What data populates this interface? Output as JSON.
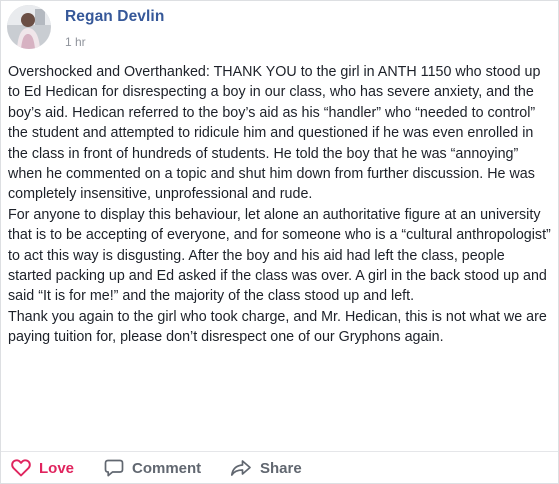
{
  "post": {
    "author": "Regan Devlin",
    "timestamp": "1 hr",
    "paragraphs": [
      "Overshocked and Overthanked: THANK YOU to the girl in ANTH 1150 who stood up to Ed Hedican for disrespecting a boy in our class, who has severe anxiety, and the boy’s aid. Hedican referred to the boy’s aid as his “handler” who “needed to control” the student and attempted to ridicule him and questioned if he was even enrolled in the class in front of hundreds of students. He told the boy that he was “annoying” when he commented on a topic and shut him down from further discussion. He was completely insensitive, unprofessional and rude.",
      "For anyone to display this behaviour, let alone an authoritative figure at an university that is to be accepting of everyone, and for someone who is a “cultural anthropologist” to act this way is disgusting. After the boy and his aid had left the class, people started packing up and Ed asked if the class was over. A girl in the back stood up and said “It is for me!” and the majority of the class stood up and left.",
      "Thank you again to the girl who took charge, and Mr. Hedican, this is not what we are paying tuition for, please don’t disrespect one of our Gryphons again."
    ]
  },
  "actions": {
    "love_label": "Love",
    "comment_label": "Comment",
    "share_label": "Share"
  },
  "icons": {
    "love": "heart-icon",
    "comment": "speech-bubble-icon",
    "share": "share-arrow-icon"
  },
  "colors": {
    "author_link": "#365899",
    "love_active": "#e0245e",
    "action_gray": "#616770",
    "timestamp_gray": "#90949c",
    "body_text": "#1d2129"
  }
}
